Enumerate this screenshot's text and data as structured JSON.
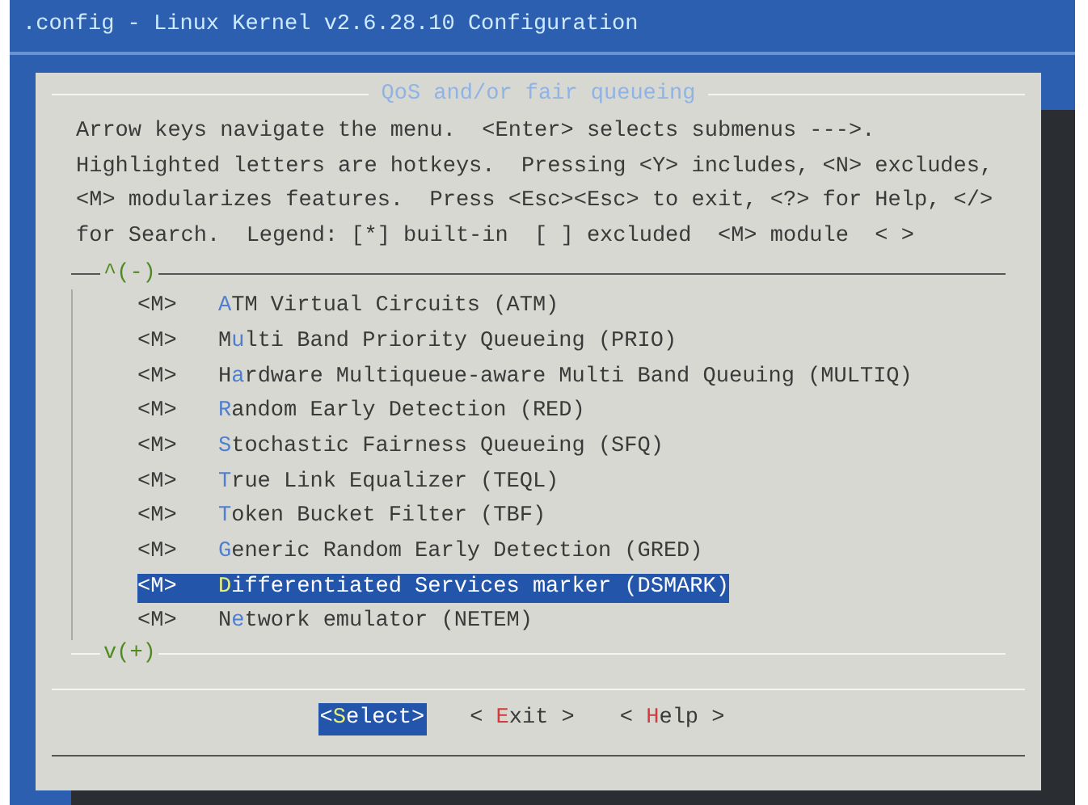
{
  "window": {
    "title": ".config - Linux Kernel v2.6.28.10 Configuration"
  },
  "dialog": {
    "title": "QoS and/or fair queueing",
    "help_lines": [
      "Arrow keys navigate the menu.  <Enter> selects submenus --->.",
      "Highlighted letters are hotkeys.  Pressing <Y> includes, <N> excludes,",
      "<M> modularizes features.  Press <Esc><Esc> to exit, <?> for Help, </>",
      "for Search.  Legend: [*] built-in  [ ] excluded  <M> module  < >"
    ],
    "scroll_up": "^(-)",
    "scroll_down": "v(+)",
    "items": [
      {
        "state": "<M>",
        "hotkey": "A",
        "post": "TM Virtual Circuits (ATM)",
        "selected": false
      },
      {
        "state": "<M>",
        "pre": "M",
        "hotkey": "u",
        "post": "lti Band Priority Queueing (PRIO)",
        "selected": false
      },
      {
        "state": "<M>",
        "pre": "H",
        "hotkey": "a",
        "post": "rdware Multiqueue-aware Multi Band Queuing (MULTIQ)",
        "selected": false
      },
      {
        "state": "<M>",
        "hotkey": "R",
        "post": "andom Early Detection (RED)",
        "selected": false
      },
      {
        "state": "<M>",
        "hotkey": "S",
        "post": "tochastic Fairness Queueing (SFQ)",
        "selected": false
      },
      {
        "state": "<M>",
        "hotkey": "T",
        "post": "rue Link Equalizer (TEQL)",
        "selected": false
      },
      {
        "state": "<M>",
        "hotkey": "T",
        "post": "oken Bucket Filter (TBF)",
        "selected": false
      },
      {
        "state": "<M>",
        "hotkey": "G",
        "post": "eneric Random Early Detection (GRED)",
        "selected": false
      },
      {
        "state": "<M>",
        "hotkey": "D",
        "post": "ifferentiated Services marker (DSMARK)",
        "selected": true
      },
      {
        "state": "<M>",
        "pre": "N",
        "hotkey": "e",
        "post": "twork emulator (NETEM)",
        "selected": false
      }
    ],
    "buttons": [
      {
        "pre": "<",
        "hotkey": "S",
        "post": "elect>",
        "selected": true
      },
      {
        "pre": "< ",
        "hotkey": "E",
        "post": "xit >",
        "selected": false
      },
      {
        "pre": "< ",
        "hotkey": "H",
        "post": "elp >",
        "selected": false
      }
    ]
  }
}
